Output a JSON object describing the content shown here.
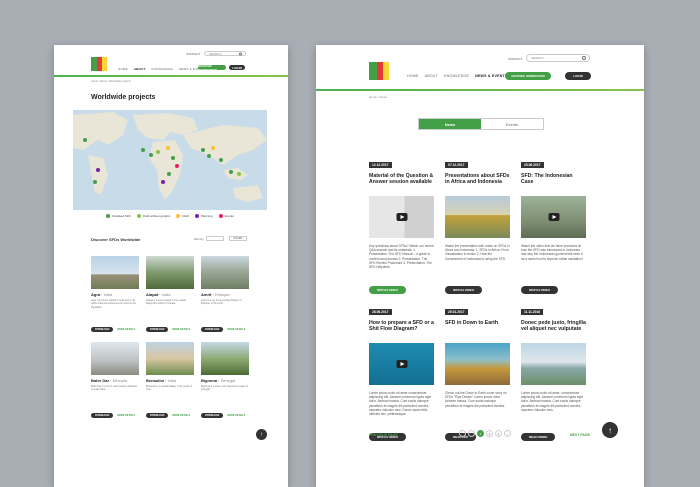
{
  "left": {
    "nav": [
      "HOME",
      "ABOUT",
      "KNOWLEDGE",
      "NEWS & EVENTS"
    ],
    "contact": "CONTACT",
    "search_placeholder": "SEARCH",
    "sfd_generator": "GRAPHIC GENERATOR",
    "login": "LOGIN",
    "breadcrumb": "Home / About / Worldwide projects",
    "page_title": "Worldwide projects",
    "legend": [
      "Finalised SFD",
      "Draft without graphic",
      "Draft",
      "Planning",
      "Events"
    ],
    "legend_colors": [
      "#43a047",
      "#8bc34a",
      "#fbc02d",
      "#7b1fa2",
      "#e91e63"
    ],
    "discover": "Discover SFDs Worldwide",
    "sort_label": "Sort by",
    "filter": "FILTER",
    "cards": [
      {
        "city": "Agra",
        "country": "India",
        "text": "Agra, the former capital of India and a city within India that welcomes the world to the Taj Mahal.",
        "btn": "DOWNLOAD",
        "more": "MORE DETAILS"
      },
      {
        "city": "Alapat",
        "country": "India",
        "text": "Alapat is a town located in the coastal Alappuzha district of Kerala.",
        "btn": "DOWNLOAD",
        "more": "MORE DETAILS"
      },
      {
        "city": "Amrit",
        "country": "Ethiopia",
        "text": "Amrit is a city in the Amhara Region of Ethiopia, in the north.",
        "btn": "DOWNLOAD",
        "more": "MORE DETAILS"
      },
      {
        "city": "Bahir Dar",
        "country": "Ethiopia",
        "text": "Bahir Dar is a city in north-western Ethiopia by Lake Tana.",
        "btn": "DOWNLOAD",
        "more": "MORE DETAILS"
      },
      {
        "city": "Benaulim",
        "country": "India",
        "text": "Benaulim is a coastal village in the south of Goa.",
        "btn": "DOWNLOAD",
        "more": "MORE DETAILS"
      },
      {
        "city": "Bignona",
        "country": "Senegal",
        "text": "Bignona is a town in the Ziguinchor region of Senegal.",
        "btn": "DOWNLOAD",
        "more": "MORE DETAILS"
      }
    ]
  },
  "right": {
    "contact": "CONTACT",
    "search_placeholder": "SEARCH",
    "nav": [
      "HOME",
      "ABOUT",
      "KNOWLEDGE",
      "NEWS & EVENTS"
    ],
    "sfd_generator": "GRAPHIC GENERATOR",
    "login": "LOGIN",
    "breadcrumb": "Home / News",
    "tabs": [
      "News",
      "Events"
    ],
    "news": [
      {
        "date": "12.12.2017",
        "title": "Material of the Question & Answer session available",
        "desc": "Any questions about SFDs? Watch our recent Q&A session and its materials: 1. Presentation: The SFD Manual – a guide to content and process 2. Presentation: The SFD Review Procedure 3. Presentation: The SFD Helpdesk",
        "action": "WATCH VIDEO",
        "green": true,
        "play": false
      },
      {
        "date": "07.12.2017",
        "title": "Presentations about SFDs in Africa and Indonesia",
        "desc": "Watch the presentation with notes on SFDs in Africa and Indonesia: 1. SFDs in Africa: From Visualisation to Action 2. How the Government of Indonesia is using the SFD.",
        "action": "WATCH VIDEO",
        "green": false,
        "play": false
      },
      {
        "date": "25.06.2017",
        "title": "SFD: The Indonesian Case",
        "desc": "Watch the video that we have produced on how the SFD was introduced in Indonesia and why the Indonesian government sees it as a useful tool to improve urban sanitation!",
        "action": "WATCH VIDEO",
        "green": false,
        "play": true
      },
      {
        "date": "28.06.2017",
        "title": "How to prepare a SFD or a Shit Flow Diagram?",
        "desc": "Lorem ipsum dolor sit amet consectetuer adipiscing elit. Aenean commodo ligula eget dolor. Aenean massa. Cum sociis natoque penatibus et magnis dis parturient montes, nascetur ridiculus mus. Donec quam felis, ultricies nec, pellentesque.",
        "action": "WATCH VIDEO",
        "green": false,
        "play": true
      },
      {
        "date": "29.01.2017",
        "title": "SFD in Down to Earth",
        "desc": "Check out the Down to Earth cover story on SFDs \"Pipe Dream\" Lorem ipsum dolor. Aenean massa. Cum sociis natoque penatibus et magnis dis parturient montes.",
        "action": "READ PDF",
        "green": false,
        "play": false
      },
      {
        "date": "11.11.2016",
        "title": "Donec pede justo, fringilla vel aliquet nec vulputate",
        "desc": "Lorem ipsum dolor sit amet, consectetuer adipiscing elit. Aenean commodo ligula eget dolor. Aenean massa. Cum sociis natoque penatibus et magnis dis parturient montes, nascetur ridiculus mus.",
        "action": "READ MORE",
        "green": false,
        "play": false
      }
    ],
    "prev": "PREVIOUS PAGE",
    "next": "NEXT PAGE",
    "pages": [
      "1",
      "2",
      "3",
      "4"
    ],
    "current_page": "2"
  }
}
